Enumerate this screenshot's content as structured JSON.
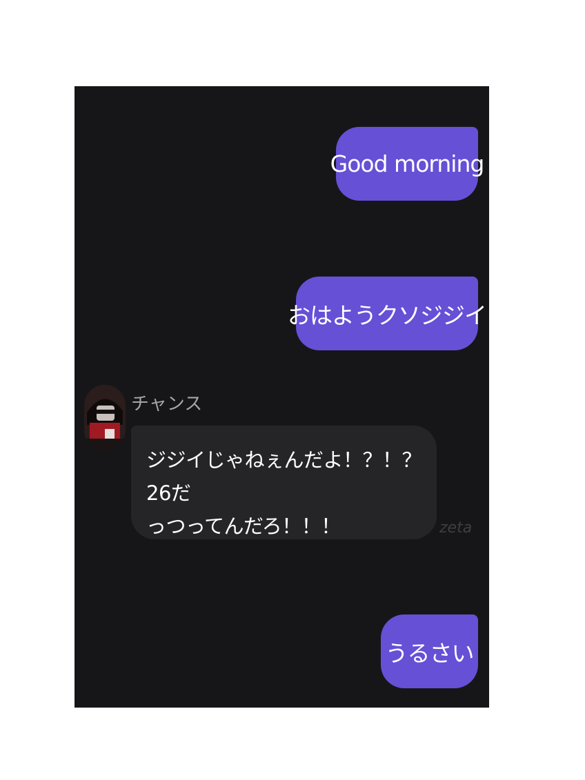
{
  "messages": {
    "outgoing_1": "Good morning",
    "outgoing_2": "おはようクソジジイ",
    "incoming": {
      "sender": "チャンス",
      "line_1": "ジジイじゃねぇんだよ！？！？26だ",
      "line_2": "っつってんだろ！！！",
      "watermark": "zeta"
    },
    "outgoing_3": "うるさい"
  },
  "colors": {
    "background": "#161618",
    "outgoing_bubble": "#6650d6",
    "incoming_bubble": "#252527"
  }
}
